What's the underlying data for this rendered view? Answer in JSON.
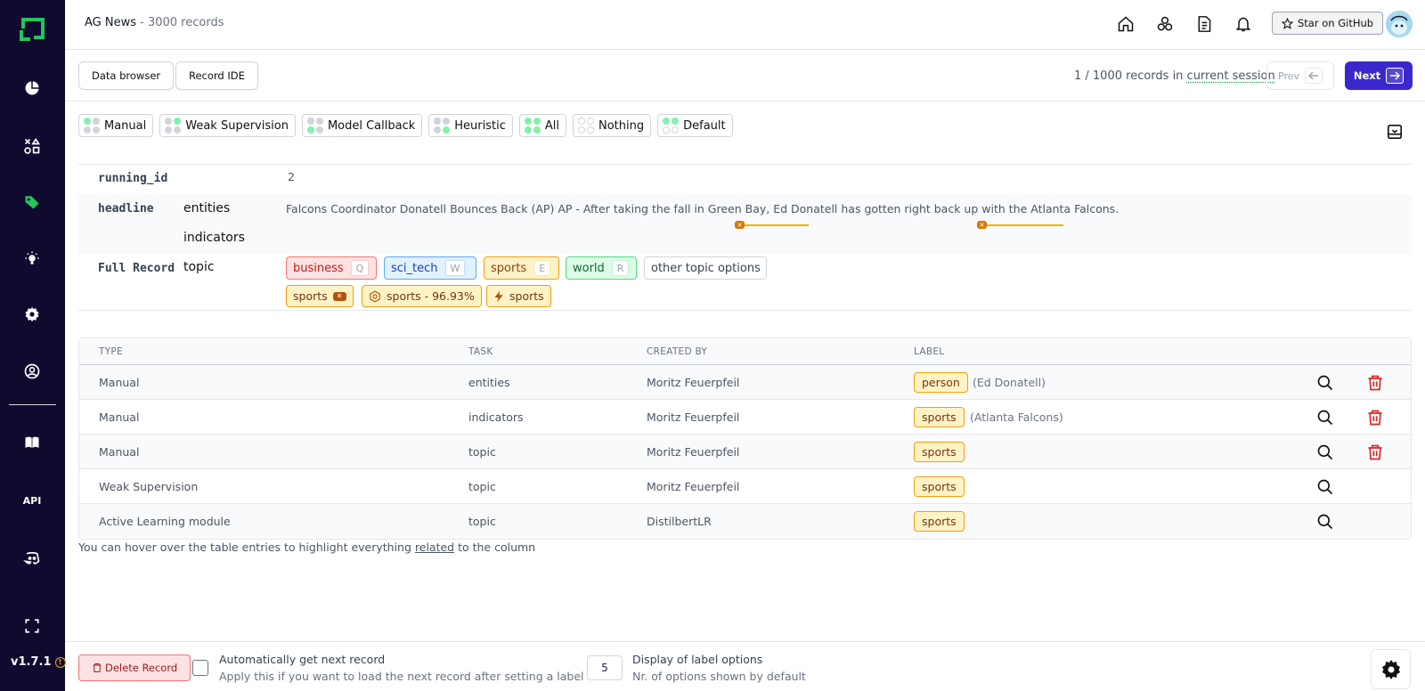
{
  "sidebar": {
    "version": "v1.7.1",
    "api_label": "API"
  },
  "header": {
    "project_name": "AG News",
    "separator": " - ",
    "record_count": "3000 records",
    "github_label": "Star on GitHub"
  },
  "navbar": {
    "data_browser": "Data browser",
    "record_ide": "Record IDE",
    "session_prefix": "1 / 1000 records in ",
    "session_link": "current session",
    "prev_label": "Prev",
    "next_label": "Next"
  },
  "chips": [
    "Manual",
    "Weak Supervision",
    "Model Callback",
    "Heuristic",
    "All",
    "Nothing",
    "Default"
  ],
  "record": {
    "running_id_name": "running_id",
    "running_id_value": "2",
    "headline_name": "headline",
    "task_entities": "entities",
    "task_indicators": "indicators",
    "headline_text": "Falcons Coordinator Donatell Bounces Back (AP) AP - After taking the fall in Green Bay, Ed Donatell has gotten right back up with the Atlanta Falcons.",
    "full_record_name": "Full Record",
    "task_topic": "topic",
    "label_options": [
      {
        "label": "business",
        "key": "Q"
      },
      {
        "label": "sci_tech",
        "key": "W"
      },
      {
        "label": "sports",
        "key": "E"
      },
      {
        "label": "world",
        "key": "R"
      }
    ],
    "other_options": "other topic options",
    "manual_label": "sports",
    "model_label": "sports - 96.93%",
    "ws_label": "sports"
  },
  "table": {
    "headers": [
      "TYPE",
      "TASK",
      "CREATED BY",
      "LABEL"
    ],
    "rows": [
      {
        "type": "Manual",
        "task": "entities",
        "created_by": "Moritz Feuerpfeil",
        "label": "person",
        "extra": "(Ed Donatell)"
      },
      {
        "type": "Manual",
        "task": "indicators",
        "created_by": "Moritz Feuerpfeil",
        "label": "sports",
        "extra": "(Atlanta Falcons)"
      },
      {
        "type": "Manual",
        "task": "topic",
        "created_by": "Moritz Feuerpfeil",
        "label": "sports",
        "extra": ""
      },
      {
        "type": "Weak Supervision",
        "task": "topic",
        "created_by": "Moritz Feuerpfeil",
        "label": "sports",
        "extra": ""
      },
      {
        "type": "Active Learning module",
        "task": "topic",
        "created_by": "DistilbertLR",
        "label": "sports",
        "extra": ""
      }
    ],
    "hint_prefix": "You can hover over the table entries to highlight everything ",
    "hint_link": "related",
    "hint_suffix": " to the column"
  },
  "footer": {
    "delete_label": "Delete Record",
    "auto_title": "Automatically get next record",
    "auto_sub": "Apply this if you want to load the next record after setting a label",
    "options_value": "5",
    "options_title": "Display of label options",
    "options_sub": "Nr. of options shown by default"
  },
  "colors": {
    "sidebar": "#0f0a2e",
    "accent": "#3b28cc",
    "logo": "#22c55e"
  }
}
